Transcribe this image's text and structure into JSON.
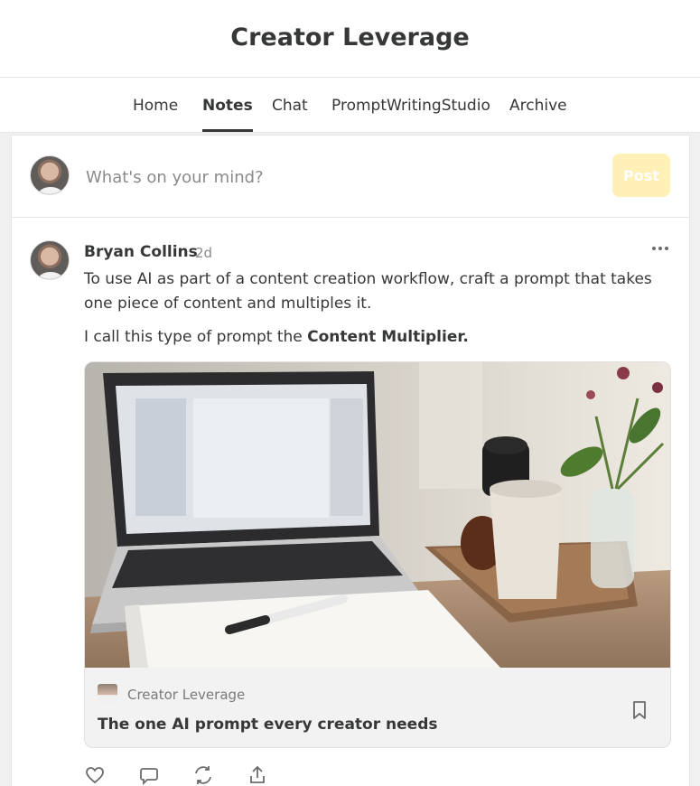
{
  "publication": {
    "title": "Creator Leverage"
  },
  "nav": {
    "tabs": [
      {
        "label": "Home",
        "active": false
      },
      {
        "label": "Notes",
        "active": true
      },
      {
        "label": "Chat",
        "active": false
      },
      {
        "label": "PromptWritingStudio",
        "active": false
      },
      {
        "label": "Archive",
        "active": false
      }
    ]
  },
  "composer": {
    "placeholder": "What's on your mind?",
    "post_label": "Post"
  },
  "note": {
    "author": "Bryan Collins",
    "age": "2d",
    "paragraph1": "To use AI as part of a content creation workflow, craft a prompt that takes one piece of content and multiples it.",
    "paragraph2_prefix": "I call this type of prompt the ",
    "paragraph2_bold": "Content Multiplier.",
    "embed": {
      "publication": "Creator Leverage",
      "title": "The one AI prompt every creator needs"
    }
  },
  "icons": {
    "more": "more-horizontal-icon",
    "bookmark": "bookmark-icon",
    "like": "heart-icon",
    "comment": "comment-icon",
    "restack": "restack-icon",
    "share": "share-icon"
  },
  "colors": {
    "post_button_bg": "#fff0b8",
    "text": "#363737"
  }
}
